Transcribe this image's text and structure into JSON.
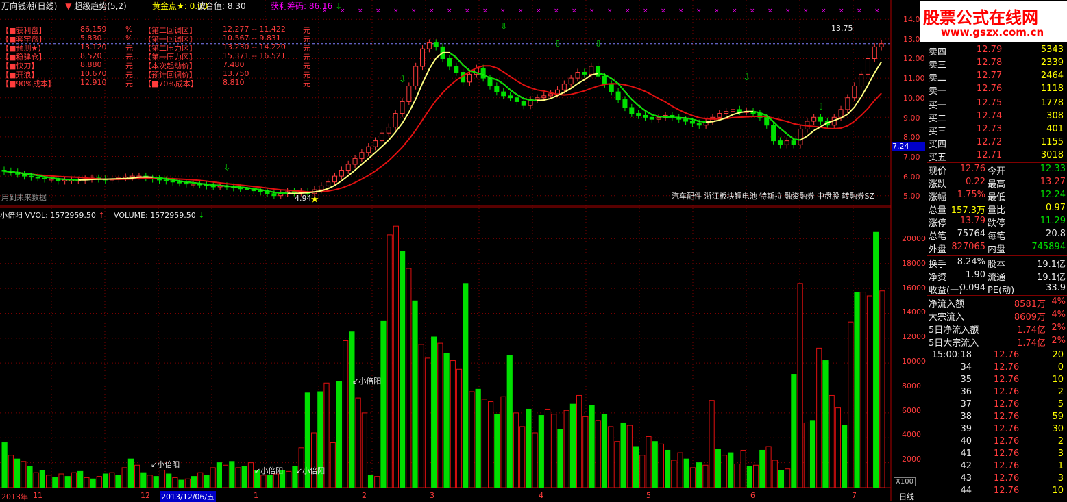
{
  "header": {
    "title": "万向钱潮(日线)",
    "indicator": "超级趋势(5,2)",
    "gold_label": "黄金点★:",
    "gold_value": "0.00",
    "wave_label": "波合值:",
    "wave_value": "8.30",
    "chip_label": "获利筹码:",
    "chip_value": "86.16"
  },
  "info": {
    "left": [
      {
        "label": "【■获利盘】",
        "value": "86.159",
        "unit": "%"
      },
      {
        "label": "【■套牢盘】",
        "value": "5.830",
        "unit": "%"
      },
      {
        "label": "【■预测★】",
        "value": "13.120",
        "unit": "元"
      },
      {
        "label": "【■稳建仓】",
        "value": "8.520",
        "unit": "元"
      },
      {
        "label": "【■快刀】",
        "value": "8.880",
        "unit": "元"
      },
      {
        "label": "【■开浪】",
        "value": "10.670",
        "unit": "元"
      },
      {
        "label": "【■90%成本】",
        "value": "12.910",
        "unit": "元"
      }
    ],
    "right": [
      {
        "label": "【第二回调区】",
        "value": "12.277  --  11.422",
        "unit": "元"
      },
      {
        "label": "【第一回调区】",
        "value": "10.567  --  9.831",
        "unit": "元"
      },
      {
        "label": "【第二压力区】",
        "value": "13.230  --  14.220",
        "unit": "元"
      },
      {
        "label": "【第一压力区】",
        "value": "15.371  --  16.521",
        "unit": "元"
      },
      {
        "label": "【本次起动价】",
        "value": "7.480",
        "unit": "元"
      },
      {
        "label": "【预计回调价】",
        "value": "13.750",
        "unit": "元"
      },
      {
        "label": "【■70%成本】",
        "value": "8.810",
        "unit": "元"
      }
    ]
  },
  "main_chart": {
    "future_note": "用到未来数据",
    "sectors": "汽车配件 浙江板块锂电池 特斯拉 融资融券 中盘股 转融券SZ",
    "high_label": "13.75",
    "low_label": "4.94",
    "current_price_tag": "7.24",
    "y_ticks": [
      "14.00",
      "13.00",
      "12.00",
      "11.00",
      "10.00",
      "9.00",
      "8.00",
      "7.00",
      "6.00",
      "5.00"
    ]
  },
  "volume_chart": {
    "label": "小倍阳  VVOL: 1572959.50",
    "label2": "VOLUME: 1572959.50",
    "signal_text": "小倍阳",
    "scale_note": "X100",
    "y_ticks": [
      "20000",
      "18000",
      "16000",
      "14000",
      "12000",
      "10000",
      "8000",
      "6000",
      "4000",
      "2000"
    ]
  },
  "x_axis": {
    "labels": [
      "2013年",
      "11",
      "12",
      "2013/12/06/五",
      "1",
      "2",
      "3",
      "4",
      "5",
      "6",
      "7"
    ],
    "period": "日线"
  },
  "logo": {
    "title": "股票公式在线网",
    "url": "www.gszx.com.cn"
  },
  "quote": {
    "asks": [
      {
        "label": "卖四",
        "price": "12.79",
        "vol": "5343"
      },
      {
        "label": "卖三",
        "price": "12.78",
        "vol": "2339"
      },
      {
        "label": "卖二",
        "price": "12.77",
        "vol": "2464"
      },
      {
        "label": "卖一",
        "price": "12.76",
        "vol": "1118"
      }
    ],
    "bids": [
      {
        "label": "买一",
        "price": "12.75",
        "vol": "1778"
      },
      {
        "label": "买二",
        "price": "12.74",
        "vol": "308"
      },
      {
        "label": "买三",
        "price": "12.73",
        "vol": "401"
      },
      {
        "label": "买四",
        "price": "12.72",
        "vol": "1155"
      },
      {
        "label": "买五",
        "price": "12.71",
        "vol": "3018"
      }
    ],
    "stats": [
      {
        "l1": "现价",
        "v1": "12.76",
        "c1": "red",
        "l2": "今开",
        "v2": "12.33",
        "c2": "green"
      },
      {
        "l1": "涨跌",
        "v1": "0.22",
        "c1": "red",
        "l2": "最高",
        "v2": "13.27",
        "c2": "red"
      },
      {
        "l1": "涨幅",
        "v1": "1.75%",
        "c1": "red",
        "l2": "最低",
        "v2": "12.24",
        "c2": "green"
      },
      {
        "l1": "总量",
        "v1": "157.3万",
        "c1": "yellow",
        "l2": "量比",
        "v2": "0.97",
        "c2": "yellow"
      },
      {
        "l1": "涨停",
        "v1": "13.79",
        "c1": "red",
        "l2": "跌停",
        "v2": "11.29",
        "c2": "green"
      },
      {
        "l1": "总笔",
        "v1": "75764",
        "c1": "white",
        "l2": "每笔",
        "v2": "20.8",
        "c2": "white"
      },
      {
        "l1": "外盘",
        "v1": "827065",
        "c1": "red",
        "l2": "内盘",
        "v2": "745894",
        "c2": "green"
      }
    ],
    "stats2": [
      {
        "l1": "换手",
        "v1": "8.24%",
        "l2": "股本",
        "v2": "19.1亿"
      },
      {
        "l1": "净资",
        "v1": "1.90",
        "l2": "流通",
        "v2": "19.1亿"
      },
      {
        "l1": "收益(一)",
        "v1": "0.094",
        "l2": "PE(动)",
        "v2": "33.9"
      }
    ],
    "flows": [
      {
        "label": "净流入额",
        "value": "8581万",
        "pct": "4%"
      },
      {
        "label": "大宗流入",
        "value": "8609万",
        "pct": "4%"
      },
      {
        "label": "5日净流入额",
        "value": "1.74亿",
        "pct": "2%"
      },
      {
        "label": "5日大宗流入",
        "value": "1.74亿",
        "pct": "2%"
      }
    ],
    "ticks": [
      {
        "time": "15:00:18",
        "price": "12.76",
        "vol": "20"
      },
      {
        "time": "34",
        "price": "12.76",
        "vol": "0"
      },
      {
        "time": "35",
        "price": "12.76",
        "vol": "10"
      },
      {
        "time": "36",
        "price": "12.76",
        "vol": "2"
      },
      {
        "time": "37",
        "price": "12.76",
        "vol": "5"
      },
      {
        "time": "38",
        "price": "12.76",
        "vol": "59"
      },
      {
        "time": "39",
        "price": "12.76",
        "vol": "30"
      },
      {
        "time": "40",
        "price": "12.76",
        "vol": "2"
      },
      {
        "time": "41",
        "price": "12.76",
        "vol": "3"
      },
      {
        "time": "42",
        "price": "12.76",
        "vol": "1"
      },
      {
        "time": "43",
        "price": "12.76",
        "vol": "3"
      },
      {
        "time": "44",
        "price": "12.76",
        "vol": "10"
      }
    ]
  },
  "chart_data": [
    {
      "type": "candlestick",
      "title": "万向钱潮(日线)",
      "ylim": [
        4.5,
        14.5
      ],
      "series": [
        {
          "name": "close",
          "values": [
            6.25,
            6.2,
            6.1,
            6.0,
            5.95,
            5.9,
            5.85,
            5.85,
            5.75,
            5.8,
            5.8,
            5.8,
            5.85,
            5.9,
            5.85,
            5.8,
            5.85,
            5.9,
            5.95,
            6.0,
            6.0,
            5.9,
            5.85,
            5.8,
            5.75,
            5.7,
            5.65,
            5.6,
            5.6,
            5.55,
            5.5,
            5.45,
            5.5,
            5.45,
            5.4,
            5.35,
            5.3,
            5.25,
            5.2,
            5.1,
            5.0,
            5.1,
            5.2,
            5.15,
            5.2,
            5.1,
            5.3,
            5.5,
            5.7,
            6.0,
            6.3,
            6.6,
            6.9,
            7.2,
            7.5,
            7.8,
            8.2,
            8.5,
            9.2,
            9.8,
            10.6,
            11.6,
            12.5,
            12.8,
            12.6,
            12.0,
            11.6,
            11.3,
            10.8,
            11.2,
            11.5,
            11.0,
            10.6,
            10.3,
            10.1,
            10.0,
            9.8,
            9.6,
            9.9,
            10.0,
            10.1,
            10.2,
            10.4,
            10.7,
            11.0,
            11.3,
            11.2,
            11.6,
            11.1,
            10.7,
            10.3,
            9.9,
            9.5,
            9.2,
            9.1,
            9.0,
            8.9,
            9.0,
            9.1,
            9.0,
            8.9,
            8.8,
            8.7,
            8.6,
            8.8,
            9.0,
            9.2,
            9.3,
            9.4,
            9.3,
            9.3,
            9.2,
            9.0,
            8.6,
            7.8,
            7.6,
            7.8,
            7.6,
            8.4,
            8.8,
            9.0,
            8.8,
            8.6,
            9.0,
            9.4,
            10.0,
            10.6,
            11.2,
            12.0,
            12.6,
            12.76
          ]
        },
        {
          "name": "ma_fast",
          "values": []
        },
        {
          "name": "ma_slow",
          "values": []
        }
      ]
    },
    {
      "type": "bar",
      "title": "VOLUME",
      "ylim": [
        0,
        22000
      ],
      "values": [
        3600,
        2600,
        2300,
        2100,
        1700,
        1200,
        1400,
        1000,
        800,
        1100,
        900,
        1200,
        1300,
        800,
        700,
        900,
        1100,
        1200,
        1000,
        1600,
        2300,
        1800,
        1200,
        1000,
        900,
        1400,
        1100,
        800,
        600,
        700,
        900,
        1200,
        1000,
        1600,
        2000,
        1800,
        2100,
        1600,
        1700,
        2000,
        1400,
        1000,
        1000,
        1100,
        1400,
        1300,
        1700,
        3200,
        7600,
        4400,
        7700,
        8400,
        3600,
        8500,
        11800,
        12500,
        7200,
        6000,
        1000,
        900,
        13400,
        20300,
        21000,
        19000,
        17600,
        15000,
        11500,
        10400,
        12100,
        11600,
        10800,
        10200,
        9500,
        16400,
        7700,
        7900,
        7100,
        6900,
        5900,
        7300,
        10600,
        6000,
        4900,
        6300,
        4400,
        5800,
        6300,
        5900,
        4700,
        6200,
        6700,
        7400,
        5700,
        6600,
        5400,
        5900,
        4900,
        3700,
        5200,
        5000,
        3300,
        2600,
        4100,
        3700,
        3500,
        3000,
        2200,
        2800,
        2300,
        1600,
        2000,
        1800,
        7000,
        3100,
        2600,
        2800,
        1900,
        3000,
        1700,
        1800,
        3000,
        3300,
        2200,
        1400,
        1500,
        9100,
        16400,
        5200,
        5400,
        11200,
        10200,
        7400,
        6400,
        5000,
        13300,
        15700,
        15700,
        15400,
        20500,
        15800
      ]
    }
  ]
}
